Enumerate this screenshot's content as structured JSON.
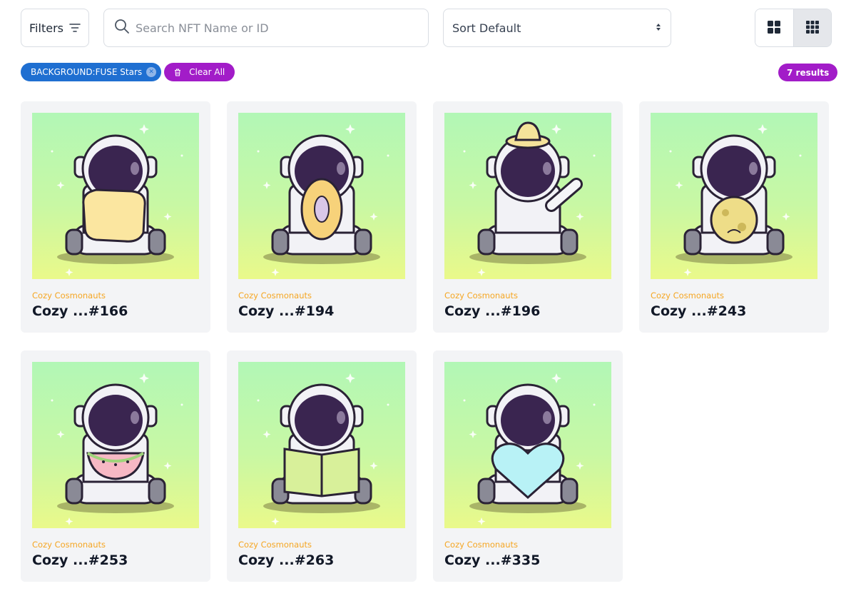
{
  "toolbar": {
    "filters_label": "Filters",
    "search_placeholder": "Search NFT Name or ID",
    "sort_label": "Sort Default"
  },
  "active_filters": {
    "chip_label": "BACKGROUND:FUSE Stars",
    "clear_label": "Clear All",
    "results_label": "7 results"
  },
  "colors": {
    "filter_chip": "#1f6fd1",
    "accent_purple": "#a21cc8",
    "collection_text": "#f5a623"
  },
  "cards": [
    {
      "collection": "Cozy Cosmonauts",
      "name": "Cozy ...#166",
      "item": "pillow"
    },
    {
      "collection": "Cozy Cosmonauts",
      "name": "Cozy ...#194",
      "item": "donut"
    },
    {
      "collection": "Cozy Cosmonauts",
      "name": "Cozy ...#196",
      "item": "hat-wave"
    },
    {
      "collection": "Cozy Cosmonauts",
      "name": "Cozy ...#243",
      "item": "moon"
    },
    {
      "collection": "Cozy Cosmonauts",
      "name": "Cozy ...#253",
      "item": "watermelon"
    },
    {
      "collection": "Cozy Cosmonauts",
      "name": "Cozy ...#263",
      "item": "book"
    },
    {
      "collection": "Cozy Cosmonauts",
      "name": "Cozy ...#335",
      "item": "heart"
    }
  ]
}
